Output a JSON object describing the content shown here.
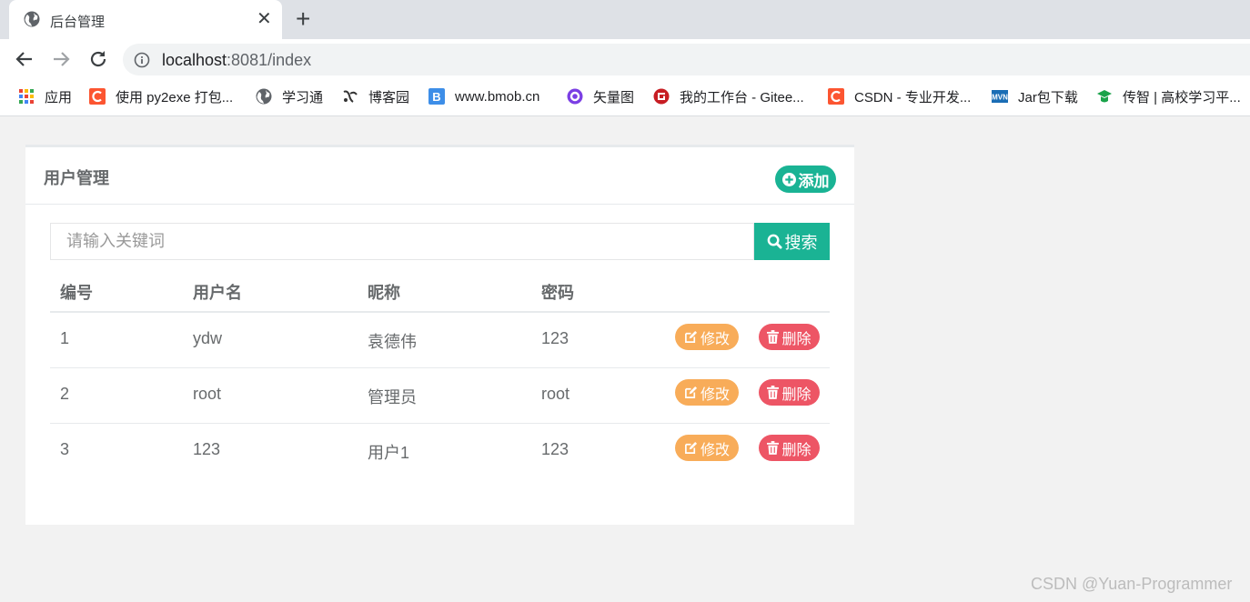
{
  "browser": {
    "tab_title": "后台管理",
    "close_glyph": "✕",
    "new_tab_glyph": "+",
    "url_host": "localhost",
    "url_rest": ":8081/index",
    "bookmarks": [
      {
        "label": "应用",
        "icon": "apps-grid-icon"
      },
      {
        "label": "使用 py2exe 打包...",
        "icon": "csdn-icon"
      },
      {
        "label": "学习通",
        "icon": "globe-icon"
      },
      {
        "label": "博客园",
        "icon": "cnblogs-icon"
      },
      {
        "label": "www.bmob.cn",
        "icon": "bmob-icon"
      },
      {
        "label": "矢量图",
        "icon": "iconfont-icon"
      },
      {
        "label": "我的工作台 - Gitee...",
        "icon": "gitee-icon"
      },
      {
        "label": "CSDN - 专业开发...",
        "icon": "csdn-icon"
      },
      {
        "label": "Jar包下载",
        "icon": "mvn-icon"
      },
      {
        "label": "传智 | 高校学习平...",
        "icon": "chuanzhi-icon"
      }
    ]
  },
  "panel": {
    "title": "用户管理",
    "add_label": "添加"
  },
  "search": {
    "placeholder": "请输入关键词",
    "button_label": "搜索"
  },
  "table": {
    "headers": [
      "编号",
      "用户名",
      "昵称",
      "密码"
    ],
    "rows": [
      {
        "id": "1",
        "username": "ydw",
        "nickname": "袁德伟",
        "password": "123"
      },
      {
        "id": "2",
        "username": "root",
        "nickname": "管理员",
        "password": "root"
      },
      {
        "id": "3",
        "username": "123",
        "nickname": "用户1",
        "password": "123"
      }
    ],
    "edit_label": "修改",
    "delete_label": "删除"
  },
  "watermark": "CSDN @Yuan-Programmer",
  "colors": {
    "primary": "#1ab394",
    "warning": "#f8ac59",
    "danger": "#ed5565",
    "text": "#676a6c"
  }
}
